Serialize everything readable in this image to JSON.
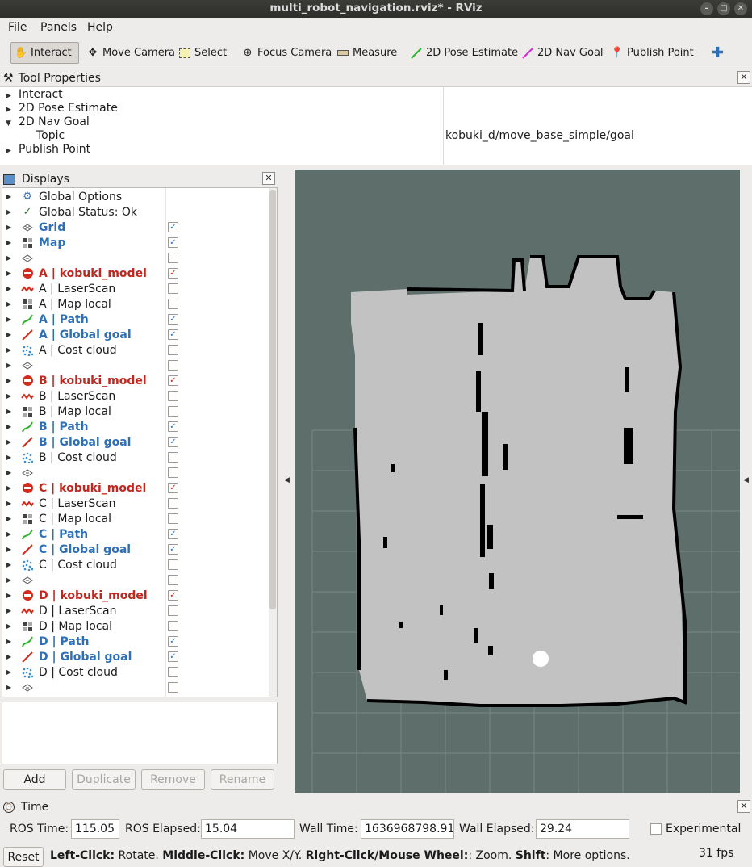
{
  "window": {
    "title": "multi_robot_navigation.rviz* - RViz"
  },
  "menu": [
    "File",
    "Panels",
    "Help"
  ],
  "toolbar": {
    "tools": [
      {
        "label": "Interact",
        "icon": "hand-icon"
      },
      {
        "label": "Move Camera",
        "icon": "move-camera-icon"
      },
      {
        "label": "Select",
        "icon": "select-icon"
      },
      {
        "label": "Focus Camera",
        "icon": "focus-camera-icon"
      },
      {
        "label": "Measure",
        "icon": "ruler-icon"
      },
      {
        "label": "2D Pose Estimate",
        "icon": "green-arrow-icon"
      },
      {
        "label": "2D Nav Goal",
        "icon": "magenta-arrow-icon"
      },
      {
        "label": "Publish Point",
        "icon": "map-pin-icon"
      }
    ]
  },
  "tool_properties": {
    "title": "Tool Properties",
    "rows": [
      "Interact",
      "2D Pose Estimate",
      "2D Nav Goal",
      "Topic",
      "Publish Point"
    ],
    "topic_value": "kobuki_d/move_base_simple/goal"
  },
  "displays": {
    "title": "Displays",
    "items": [
      {
        "label": "Global Options",
        "style": "normal",
        "icon": "gear-icon",
        "check": "none"
      },
      {
        "label": "Global Status: Ok",
        "style": "normal",
        "icon": "checkmark-icon",
        "check": "none"
      },
      {
        "label": "Grid",
        "style": "blue",
        "icon": "grid-icon",
        "check": "on"
      },
      {
        "label": "Map",
        "style": "blue",
        "icon": "map-icon",
        "check": "on"
      },
      {
        "label": "",
        "style": "normal",
        "icon": "group-icon",
        "check": "off"
      },
      {
        "label": "A | kobuki_model",
        "style": "red",
        "icon": "error-icon",
        "check": "red"
      },
      {
        "label": "A | LaserScan",
        "style": "normal",
        "icon": "laserscan-icon",
        "check": "off"
      },
      {
        "label": "A | Map local",
        "style": "normal",
        "icon": "map-icon",
        "check": "off"
      },
      {
        "label": "A | Path",
        "style": "blue",
        "icon": "path-icon",
        "check": "on"
      },
      {
        "label": "A | Global goal",
        "style": "blue",
        "icon": "goal-icon",
        "check": "on"
      },
      {
        "label": "A | Cost cloud",
        "style": "normal",
        "icon": "pointcloud-icon",
        "check": "off"
      },
      {
        "label": "",
        "style": "normal",
        "icon": "group-icon",
        "check": "off"
      },
      {
        "label": "B | kobuki_model",
        "style": "red",
        "icon": "error-icon",
        "check": "red"
      },
      {
        "label": "B | LaserScan",
        "style": "normal",
        "icon": "laserscan-icon",
        "check": "off"
      },
      {
        "label": "B | Map local",
        "style": "normal",
        "icon": "map-icon",
        "check": "off"
      },
      {
        "label": "B | Path",
        "style": "blue",
        "icon": "path-icon",
        "check": "on"
      },
      {
        "label": "B | Global goal",
        "style": "blue",
        "icon": "goal-icon",
        "check": "on"
      },
      {
        "label": "B | Cost cloud",
        "style": "normal",
        "icon": "pointcloud-icon",
        "check": "off"
      },
      {
        "label": "",
        "style": "normal",
        "icon": "group-icon",
        "check": "off"
      },
      {
        "label": "C | kobuki_model",
        "style": "red",
        "icon": "error-icon",
        "check": "red"
      },
      {
        "label": "C | LaserScan",
        "style": "normal",
        "icon": "laserscan-icon",
        "check": "off"
      },
      {
        "label": "C | Map local",
        "style": "normal",
        "icon": "map-icon",
        "check": "off"
      },
      {
        "label": "C | Path",
        "style": "blue",
        "icon": "path-icon",
        "check": "on"
      },
      {
        "label": "C | Global goal",
        "style": "blue",
        "icon": "goal-icon",
        "check": "on"
      },
      {
        "label": "C | Cost cloud",
        "style": "normal",
        "icon": "pointcloud-icon",
        "check": "off"
      },
      {
        "label": "",
        "style": "normal",
        "icon": "group-icon",
        "check": "off"
      },
      {
        "label": "D | kobuki_model",
        "style": "red",
        "icon": "error-icon",
        "check": "red"
      },
      {
        "label": "D | LaserScan",
        "style": "normal",
        "icon": "laserscan-icon",
        "check": "off"
      },
      {
        "label": "D | Map local",
        "style": "normal",
        "icon": "map-icon",
        "check": "off"
      },
      {
        "label": "D | Path",
        "style": "blue",
        "icon": "path-icon",
        "check": "on"
      },
      {
        "label": "D | Global goal",
        "style": "blue",
        "icon": "goal-icon",
        "check": "on"
      },
      {
        "label": "D | Cost cloud",
        "style": "normal",
        "icon": "pointcloud-icon",
        "check": "off"
      },
      {
        "label": "",
        "style": "normal",
        "icon": "group-icon",
        "check": "off"
      }
    ],
    "buttons": {
      "add": "Add",
      "duplicate": "Duplicate",
      "remove": "Remove",
      "rename": "Rename"
    }
  },
  "time_panel": {
    "title": "Time",
    "ros_time_label": "ROS Time:",
    "ros_time": "115.05",
    "ros_elapsed_label": "ROS Elapsed:",
    "ros_elapsed": "15.04",
    "wall_time_label": "Wall Time:",
    "wall_time": "1636968798.91",
    "wall_elapsed_label": "Wall Elapsed:",
    "wall_elapsed": "29.24",
    "experimental_label": "Experimental"
  },
  "status": {
    "reset": "Reset",
    "left_click": "Left-Click:",
    "left_click_action": " Rotate. ",
    "middle_click": "Middle-Click:",
    "middle_click_action": " Move X/Y. ",
    "right_click": "Right-Click/Mouse Wheel:",
    "right_click_action": ": Zoom. ",
    "shift": "Shift",
    "shift_action": ": More options.",
    "fps": "31 fps"
  },
  "colors": {
    "viewport_bg": "#5d6e6b",
    "map_free": "#c2c2c2",
    "map_occupied": "#000000",
    "blue_label": "#2f6fb5",
    "red_label": "#c0271f"
  }
}
